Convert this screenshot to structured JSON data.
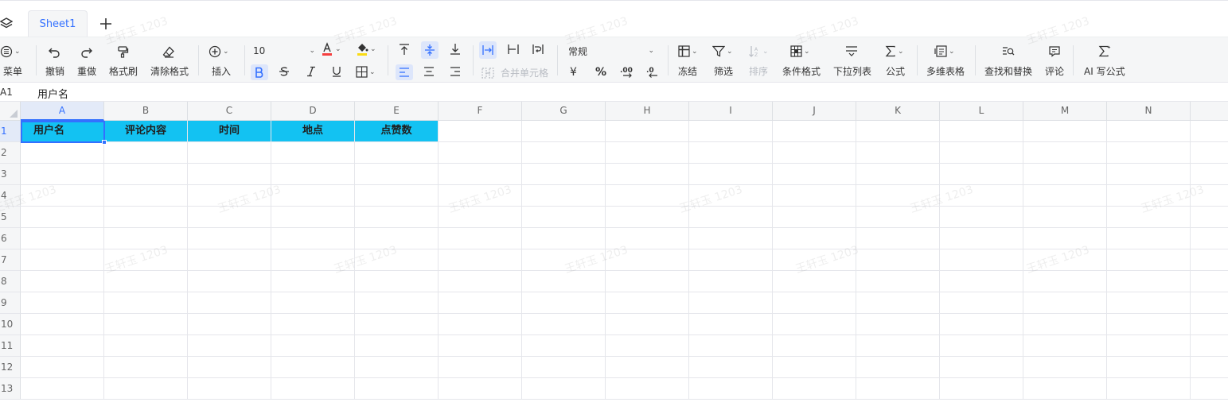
{
  "tabs": {
    "sheet1": "Sheet1"
  },
  "toolbar": {
    "menu": "菜单",
    "undo": "撤销",
    "redo": "重做",
    "format_painter": "格式刷",
    "clear_format": "清除格式",
    "insert": "插入",
    "font_size": "10",
    "merge_cells": "合并单元格",
    "number_format": "常规",
    "currency": "¥",
    "percent": "%",
    "freeze": "冻结",
    "filter": "筛选",
    "sort": "排序",
    "conditional_format": "条件格式",
    "dropdown_list": "下拉列表",
    "formula": "公式",
    "pivot_table": "多维表格",
    "find_replace": "查找和替换",
    "comment": "评论",
    "ai_formula": "AI 写公式",
    "font_color": "#f53f3f",
    "fill_color": "#fadb14",
    "accent": "#3370ff"
  },
  "formula_bar": {
    "cell_ref": "A1",
    "value": "用户名"
  },
  "grid": {
    "columns": [
      "A",
      "B",
      "C",
      "D",
      "E",
      "F",
      "G",
      "H",
      "I",
      "J",
      "K",
      "L",
      "M",
      "N"
    ],
    "rows": [
      "1",
      "2",
      "3",
      "4",
      "5",
      "6",
      "7",
      "8",
      "9",
      "10",
      "11",
      "12",
      "13"
    ],
    "header_row": [
      "用户名",
      "评论内容",
      "时间",
      "地点",
      "点赞数"
    ],
    "header_fill": "#13c2f2",
    "selected_cell": "A1"
  },
  "watermark": "王轩玉 1203"
}
